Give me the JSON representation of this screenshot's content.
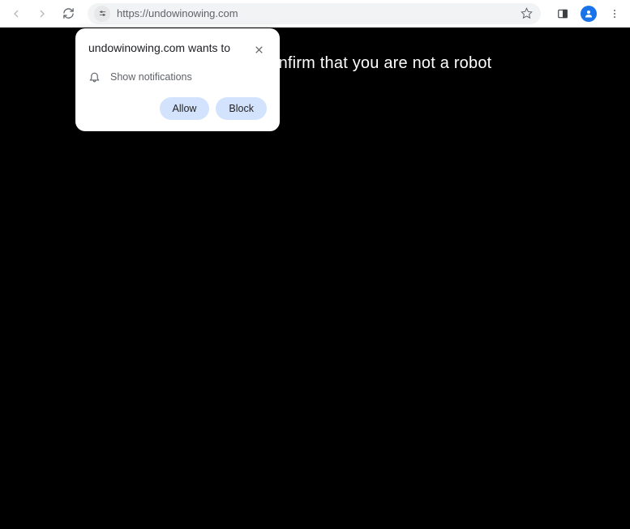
{
  "toolbar": {
    "url": "https://undowinowing.com"
  },
  "page": {
    "message": "Click \"Allow\" to confirm that you are not a robot"
  },
  "bubble": {
    "title": "undowinowing.com wants to",
    "row_text": "Show notifications",
    "allow_label": "Allow",
    "block_label": "Block"
  }
}
